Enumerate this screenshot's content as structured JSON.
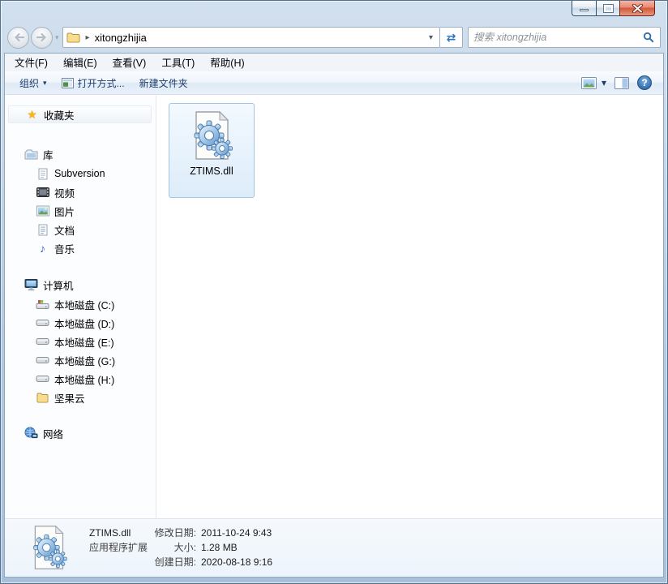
{
  "icons": {
    "chevron_down": "▾",
    "breadcrumb_arrow": "▸",
    "star": "★",
    "music_note": "♪",
    "help": "?",
    "refresh": "⇄"
  },
  "navbar": {
    "address": "xitongzhijia",
    "search_placeholder": "搜索 xitongzhijia"
  },
  "menubar": {
    "items": [
      {
        "label": "文件(F)"
      },
      {
        "label": "编辑(E)"
      },
      {
        "label": "查看(V)"
      },
      {
        "label": "工具(T)"
      },
      {
        "label": "帮助(H)"
      }
    ]
  },
  "toolbar": {
    "organize": "组织",
    "open_with": "打开方式...",
    "new_folder": "新建文件夹"
  },
  "sidebar": {
    "favorites": {
      "label": "收藏夹"
    },
    "libraries": {
      "label": "库",
      "items": [
        {
          "label": "Subversion"
        },
        {
          "label": "视频"
        },
        {
          "label": "图片"
        },
        {
          "label": "文档"
        },
        {
          "label": "音乐"
        }
      ]
    },
    "computer": {
      "label": "计算机",
      "items": [
        {
          "label": "本地磁盘 (C:)"
        },
        {
          "label": "本地磁盘 (D:)"
        },
        {
          "label": "本地磁盘 (E:)"
        },
        {
          "label": "本地磁盘 (G:)"
        },
        {
          "label": "本地磁盘 (H:)"
        },
        {
          "label": "坚果云"
        }
      ]
    },
    "network": {
      "label": "网络"
    }
  },
  "content": {
    "files": [
      {
        "name": "ZTIMS.dll"
      }
    ]
  },
  "details": {
    "name": "ZTIMS.dll",
    "type": "应用程序扩展",
    "rows": [
      {
        "label": "修改日期:",
        "value": "2011-10-24 9:43"
      },
      {
        "label": "大小:",
        "value": "1.28 MB"
      },
      {
        "label": "创建日期:",
        "value": "2020-08-18 9:16"
      }
    ]
  }
}
